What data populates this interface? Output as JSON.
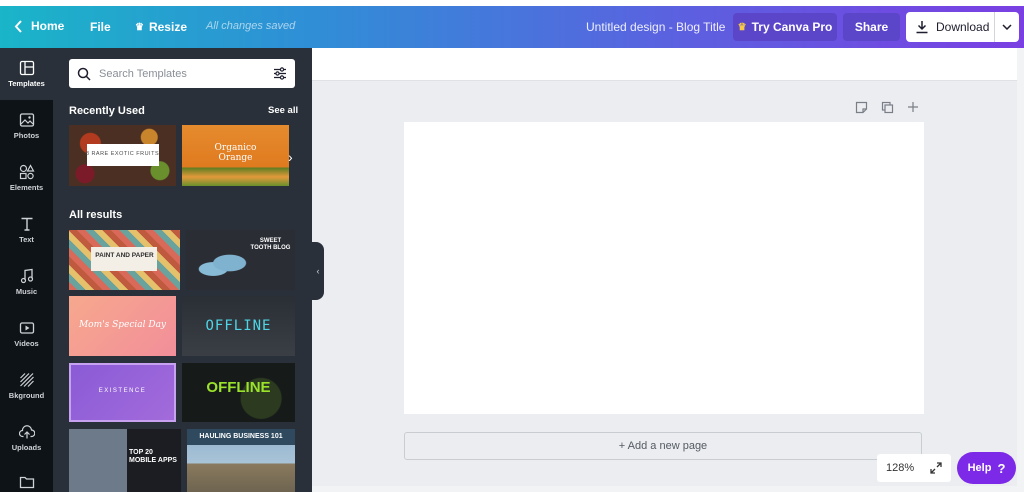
{
  "topbar": {
    "home_label": "Home",
    "file_label": "File",
    "resize_label": "Resize",
    "saved_status": "All changes saved",
    "design_title": "Untitled design - Blog Title",
    "try_pro_label": "Try Canva Pro",
    "share_label": "Share",
    "download_label": "Download"
  },
  "rail": {
    "items": [
      {
        "label": "Templates",
        "icon": "templates-icon"
      },
      {
        "label": "Photos",
        "icon": "photos-icon"
      },
      {
        "label": "Elements",
        "icon": "elements-icon"
      },
      {
        "label": "Text",
        "icon": "text-icon"
      },
      {
        "label": "Music",
        "icon": "music-icon"
      },
      {
        "label": "Videos",
        "icon": "videos-icon"
      },
      {
        "label": "Bkground",
        "icon": "background-icon"
      },
      {
        "label": "Uploads",
        "icon": "uploads-icon"
      },
      {
        "label": "",
        "icon": "folder-icon"
      }
    ]
  },
  "panel": {
    "search_placeholder": "Search Templates",
    "recently_used_title": "Recently Used",
    "see_all_label": "See all",
    "all_results_title": "All results",
    "recent": [
      {
        "text": "8 RARE EXOTIC FRUITS"
      },
      {
        "text": "Organico\nOrange"
      }
    ],
    "results": [
      {
        "text": "PAINT AND PAPER"
      },
      {
        "text": "SWEET\nTOOTH BLOG"
      },
      {
        "text": "Mom's Special Day"
      },
      {
        "text": "OFFLINE"
      },
      {
        "text": "EXISTENCE"
      },
      {
        "text": "OFFLINE"
      },
      {
        "text": "TOP 20\nMOBILE APPS"
      },
      {
        "text": "HAULING BUSINESS 101"
      }
    ]
  },
  "canvas": {
    "add_page_label": "+ Add a new page",
    "zoom_level": "128%",
    "help_label": "Help",
    "help_mark": "?"
  },
  "colors": {
    "accent": "#7d2ae8",
    "rail_bg": "#0e1318",
    "panel_bg": "#293039"
  }
}
